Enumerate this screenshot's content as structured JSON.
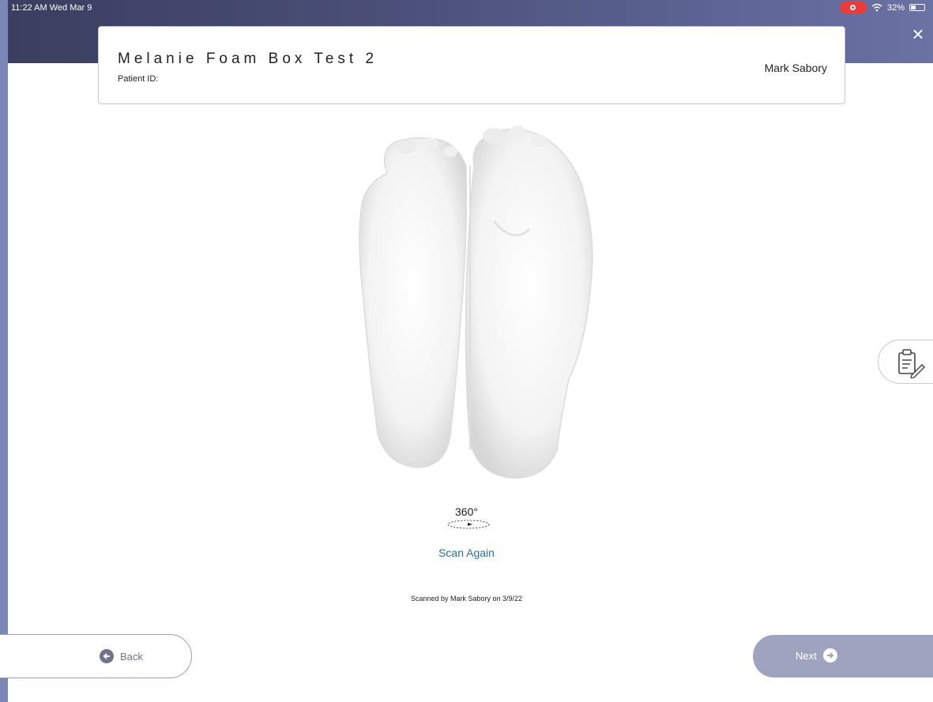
{
  "status_bar": {
    "time": "11:22 AM  Wed Mar 9",
    "battery": "32%"
  },
  "header": {
    "patient_name": "Melanie Foam Box Test 2",
    "patient_id_label": "Patient ID:",
    "clinician": "Mark Sabory"
  },
  "scan": {
    "rotate_label": "360°",
    "scan_again": "Scan Again",
    "scanned_by": "Scanned by Mark Sabory on 3/9/22"
  },
  "nav": {
    "back_label": "Back",
    "next_label": "Next"
  },
  "icons": {
    "close": "close-icon",
    "notes": "clipboard-edit-icon",
    "rotate": "rotate-360-icon",
    "back": "arrow-left-circle-icon",
    "next": "arrow-right-circle-icon"
  },
  "colors": {
    "header_band": "#3a3e60",
    "link": "#2b6fa3",
    "next_button": "#9ea3bf",
    "recording": "#ea3b3b"
  }
}
